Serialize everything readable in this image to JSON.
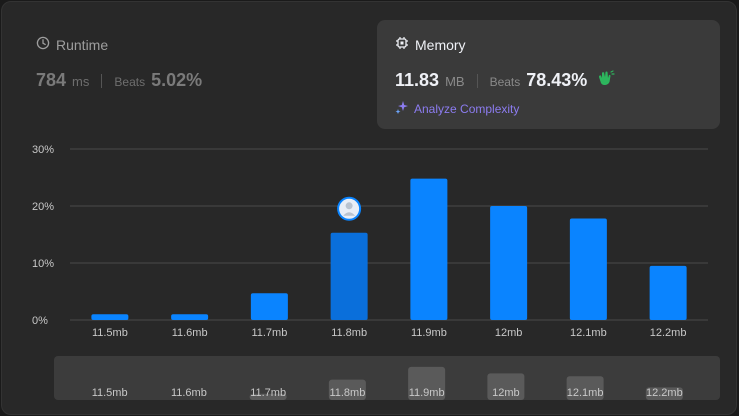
{
  "runtime": {
    "title": "Runtime",
    "value": "784",
    "unit": "ms",
    "beats_label": "Beats",
    "beats_value": "5.02%"
  },
  "memory": {
    "title": "Memory",
    "value": "11.83",
    "unit": "MB",
    "beats_label": "Beats",
    "beats_value": "78.43%",
    "analyze_label": "Analyze Complexity"
  },
  "colors": {
    "bar": "#0a84ff",
    "bar_highlight": "#0a6fdb",
    "grid": "#4a4a4a",
    "accent_purple": "#8c7cf0",
    "clap_green": "#2db55d"
  },
  "chart_data": {
    "type": "bar",
    "categories": [
      "11.5mb",
      "11.6mb",
      "11.7mb",
      "11.8mb",
      "11.9mb",
      "12mb",
      "12.1mb",
      "12.2mb"
    ],
    "values": [
      1.0,
      1.0,
      4.7,
      15.3,
      24.8,
      20.0,
      17.8,
      9.5
    ],
    "yticks": [
      "0%",
      "10%",
      "20%",
      "30%"
    ],
    "ylim": [
      0,
      30
    ],
    "grid": true,
    "user_bin": "11.8mb",
    "title": "",
    "xlabel": "",
    "ylabel": ""
  }
}
